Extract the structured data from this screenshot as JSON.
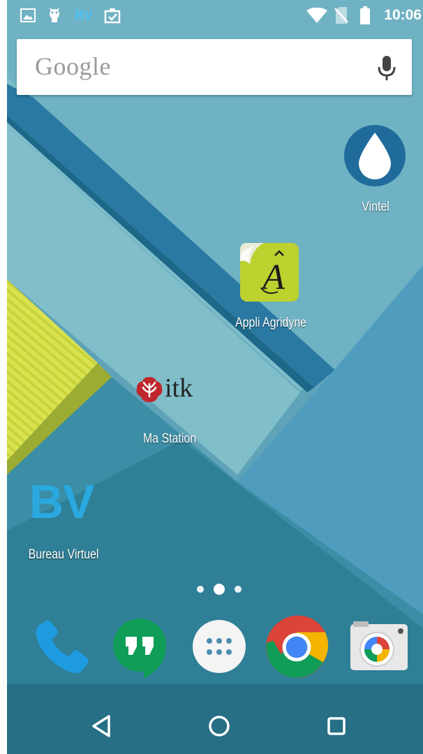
{
  "status_bar": {
    "notification_icons": [
      "image-icon",
      "android-icon",
      "bv-icon",
      "clipboard-check-icon"
    ],
    "bv_text": "BV",
    "system_icons": [
      "wifi-icon",
      "no-sim-icon",
      "battery-icon"
    ],
    "time": "10:06"
  },
  "search": {
    "logo_text": "Google",
    "icon": "mic-icon"
  },
  "apps": [
    {
      "label": "Vintel",
      "icon": "water-drop-icon"
    },
    {
      "label": "Appli Agridyne",
      "icon": "agridyne-icon"
    },
    {
      "label": "Ma Station",
      "icon": "itk-icon",
      "icon_text": "itk"
    },
    {
      "label": "Bureau Virtuel",
      "icon": "bv-app-icon",
      "icon_text": "BV"
    }
  ],
  "page_indicator": {
    "pages": 3,
    "current": 2
  },
  "dock": [
    "phone-icon",
    "hangouts-icon",
    "app-drawer-icon",
    "chrome-icon",
    "camera-icon"
  ],
  "nav_bar": [
    "back-icon",
    "home-icon",
    "recents-icon"
  ],
  "colors": {
    "bv_blue": "#29a9e0",
    "agridyne_green": "#bdd12f",
    "vintel_blue": "#1f6b9b",
    "itk_red": "#c0262d"
  }
}
